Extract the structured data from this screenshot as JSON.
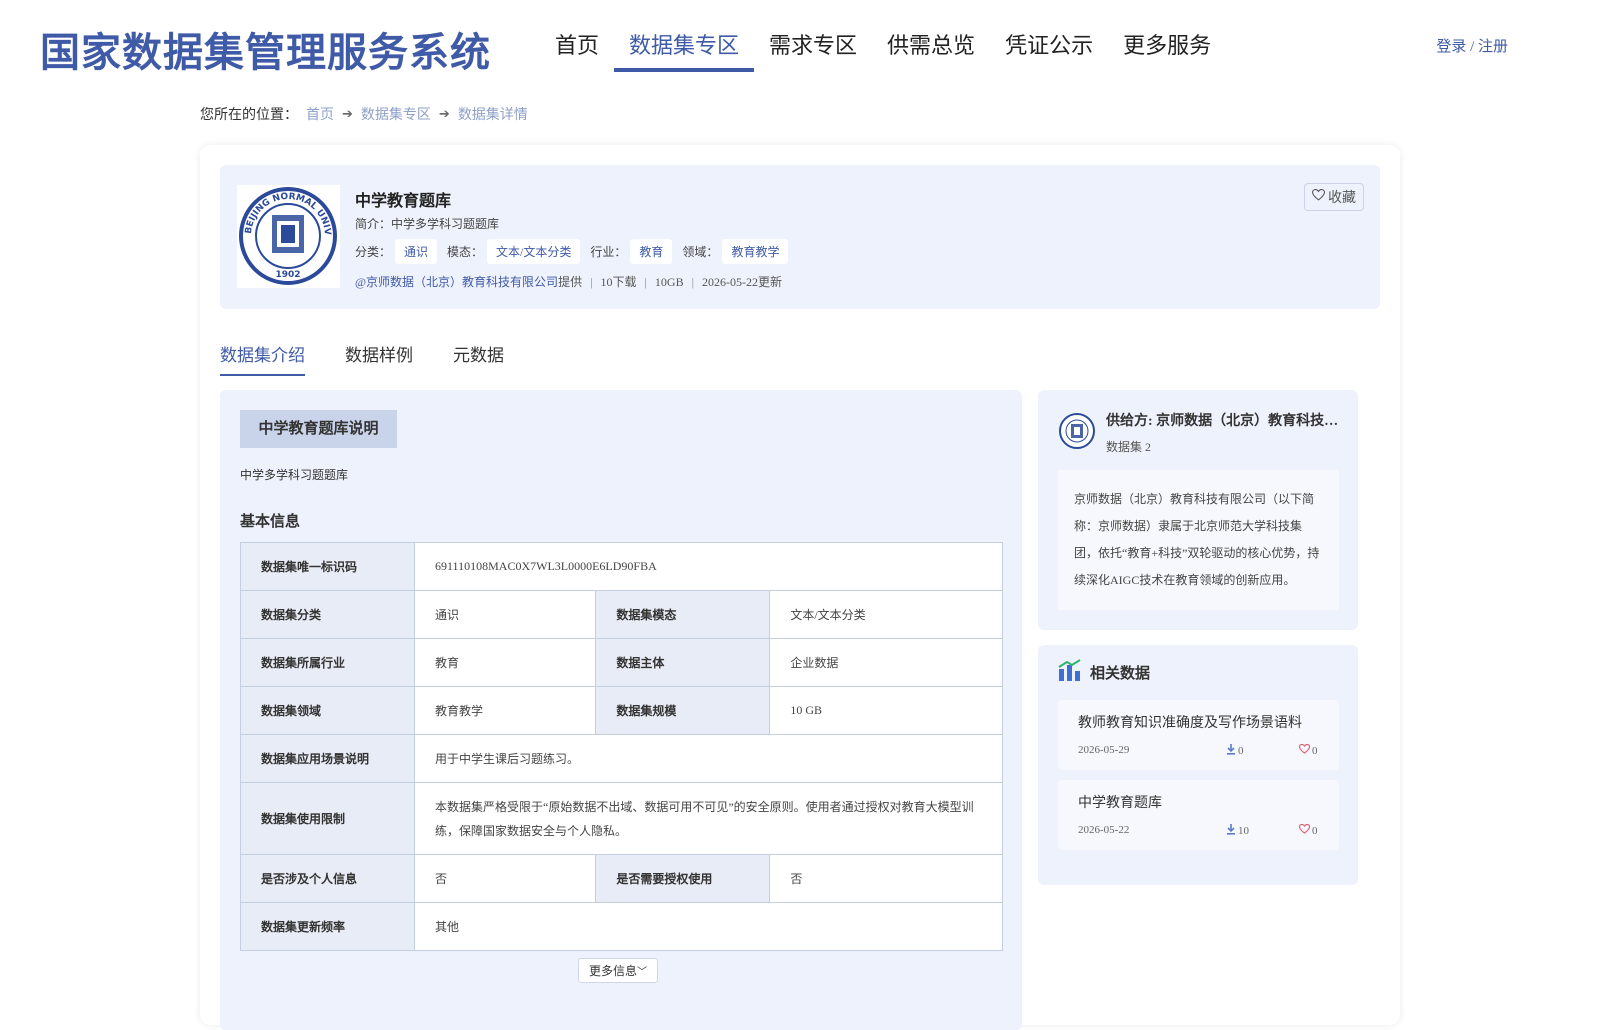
{
  "header": {
    "title": "国家数据集管理服务系统",
    "nav": [
      "首页",
      "数据集专区",
      "需求专区",
      "供需总览",
      "凭证公示",
      "更多服务"
    ],
    "login": "登录 / 注册"
  },
  "breadcrumb": {
    "prefix": "您所在的位置：",
    "items": [
      "首页",
      "数据集专区",
      "数据集详情"
    ]
  },
  "dataset": {
    "title": "中学教育题库",
    "intro": "简介：中学多学科习题题库",
    "logo_text": "BEIJING NORMAL UNIVERSITY 1902",
    "tag_labels": {
      "category": "分类：",
      "modality": "模态：",
      "industry": "行业：",
      "domain": "领域："
    },
    "tags": {
      "category": "通识",
      "modality": "文本/文本分类",
      "industry": "教育",
      "domain": "教育教学"
    },
    "provider": "@京师数据（北京）教育科技有限公司",
    "provider_suffix": "提供",
    "downloads": "10下载",
    "size": "10GB",
    "updated": "2026-05-22更新",
    "favorite": "收藏"
  },
  "tabs": [
    "数据集介绍",
    "数据样例",
    "元数据"
  ],
  "main": {
    "section_title": "中学教育题库说明",
    "section_desc": "中学多学科习题题库",
    "basic_info": "基本信息",
    "table": {
      "uid_k": "数据集唯一标识码",
      "uid_v": "691110108MAC0X7WL3L0000E6LD90FBA",
      "cat_k": "数据集分类",
      "cat_v": "通识",
      "mod_k": "数据集模态",
      "mod_v": "文本/文本分类",
      "ind_k": "数据集所属行业",
      "ind_v": "教育",
      "sub_k": "数据主体",
      "sub_v": "企业数据",
      "dom_k": "数据集领域",
      "dom_v": "教育教学",
      "scale_k": "数据集规模",
      "scale_v": "10 GB",
      "app_k": "数据集应用场景说明",
      "app_v": "用于中学生课后习题练习。",
      "lim_k": "数据集使用限制",
      "lim_v": "本数据集严格受限于“原始数据不出域、数据可用不可见”的安全原则。使用者通过授权对教育大模型训练，保障国家数据安全与个人隐私。",
      "pii_k": "是否涉及个人信息",
      "pii_v": "否",
      "auth_k": "是否需要授权使用",
      "auth_v": "否",
      "freq_k": "数据集更新频率",
      "freq_v": "其他"
    },
    "more": "更多信息"
  },
  "supplier": {
    "name": "供给方: 京师数据（北京）教育科技有限公司",
    "count": "数据集 2",
    "desc": "京师数据（北京）教育科技有限公司（以下简称：京师数据）隶属于北京师范大学科技集团，依托“教育+科技”双轮驱动的核心优势，持续深化AIGC技术在教育领域的创新应用。"
  },
  "related": {
    "title": "相关数据",
    "items": [
      {
        "title": "教师教育知识准确度及写作场景语料",
        "date": "2026-05-29",
        "downloads": "0",
        "likes": "0"
      },
      {
        "title": "中学教育题库",
        "date": "2026-05-22",
        "downloads": "10",
        "likes": "0"
      }
    ]
  },
  "colors": {
    "brand": "#3f5aa6",
    "panel": "#eef2fc",
    "like": "#e05a6a"
  }
}
